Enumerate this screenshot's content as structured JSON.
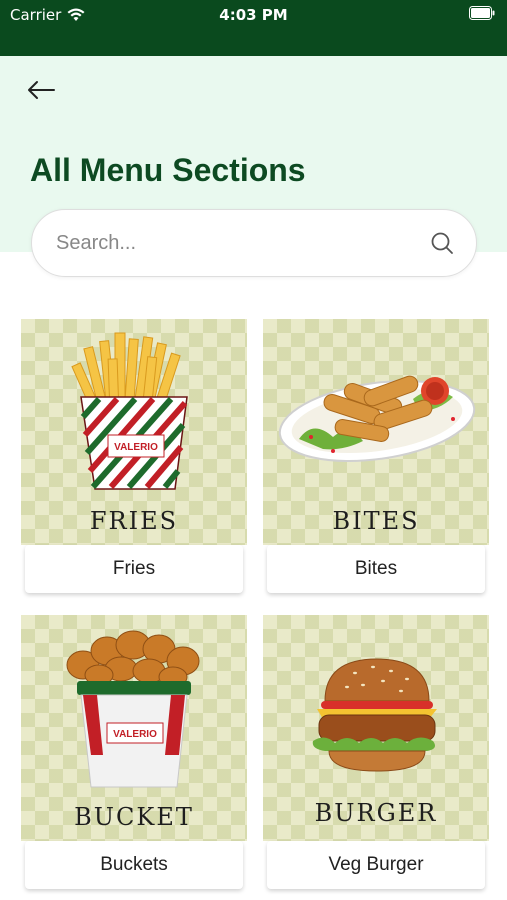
{
  "status_bar": {
    "carrier": "Carrier",
    "time": "4:03 PM"
  },
  "header": {
    "title": "All Menu Sections"
  },
  "search": {
    "placeholder": "Search..."
  },
  "sections": [
    {
      "image_title": "FRIES",
      "label": "Fries"
    },
    {
      "image_title": "BITES",
      "label": "Bites"
    },
    {
      "image_title": "BUCKET",
      "label": "Buckets"
    },
    {
      "image_title": "BURGER",
      "label": "Veg Burger"
    }
  ],
  "brand_text": "VALERIO",
  "colors": {
    "status_bar": "#0a4a1e",
    "header_bg": "#e9f9ef",
    "title": "#0d4a22"
  }
}
